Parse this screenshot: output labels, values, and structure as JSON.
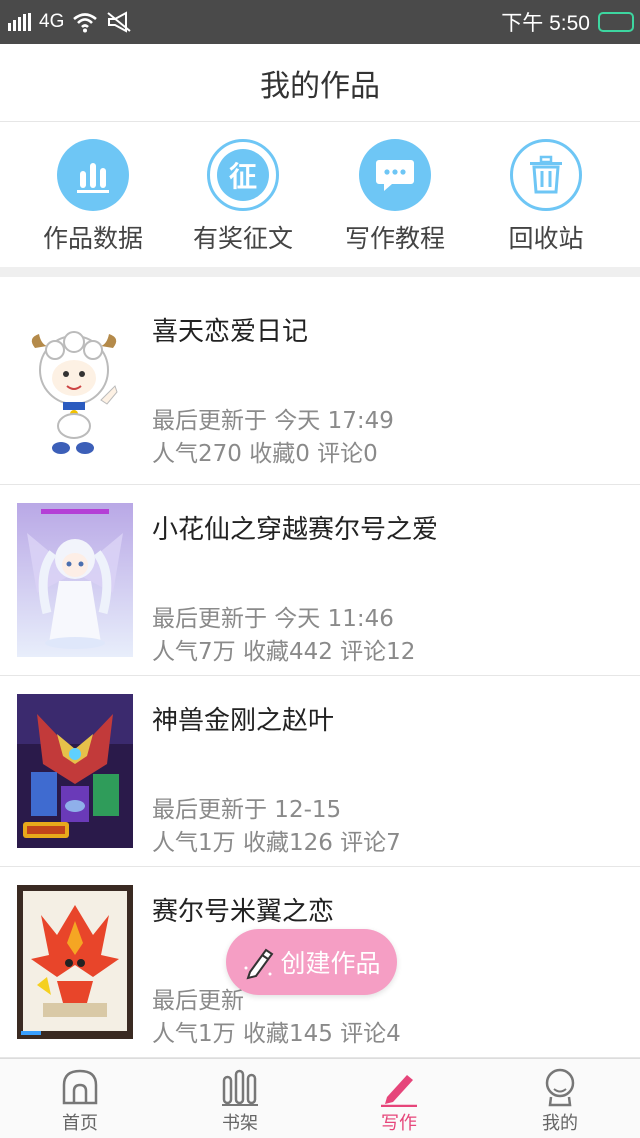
{
  "status_bar": {
    "network": "4G",
    "time": "下午 5:50"
  },
  "header": {
    "title": "我的作品"
  },
  "quick_actions": [
    {
      "label": "作品数据",
      "icon": "bar-chart-icon"
    },
    {
      "label": "有奖征文",
      "icon": "zheng-badge-icon",
      "glyph": "征"
    },
    {
      "label": "写作教程",
      "icon": "chat-bubble-icon"
    },
    {
      "label": "回收站",
      "icon": "trash-icon"
    }
  ],
  "works": [
    {
      "title": "喜天恋爱日记",
      "updated": "最后更新于 今天 17:49",
      "stats": "人气270 收藏0 评论0"
    },
    {
      "title": "小花仙之穿越赛尔号之爱",
      "updated": "最后更新于 今天 11:46",
      "stats": "人气7万 收藏442 评论12"
    },
    {
      "title": "神兽金刚之赵叶",
      "updated": "最后更新于 12-15",
      "stats": "人气1万 收藏126 评论7"
    },
    {
      "title": "赛尔号米翼之恋",
      "updated": "最后更新",
      "stats": "人气1万 收藏145 评论4"
    }
  ],
  "fab": {
    "label": "创建作品"
  },
  "tabs": [
    {
      "label": "首页",
      "icon": "home-icon"
    },
    {
      "label": "书架",
      "icon": "bookshelf-icon"
    },
    {
      "label": "写作",
      "icon": "pencil-icon",
      "active": true
    },
    {
      "label": "我的",
      "icon": "profile-icon"
    }
  ],
  "colors": {
    "accent_blue": "#6ec6f5",
    "accent_pink": "#e6457a",
    "fab_pink": "#f59ec4",
    "status_bar": "#4a4a4a"
  }
}
